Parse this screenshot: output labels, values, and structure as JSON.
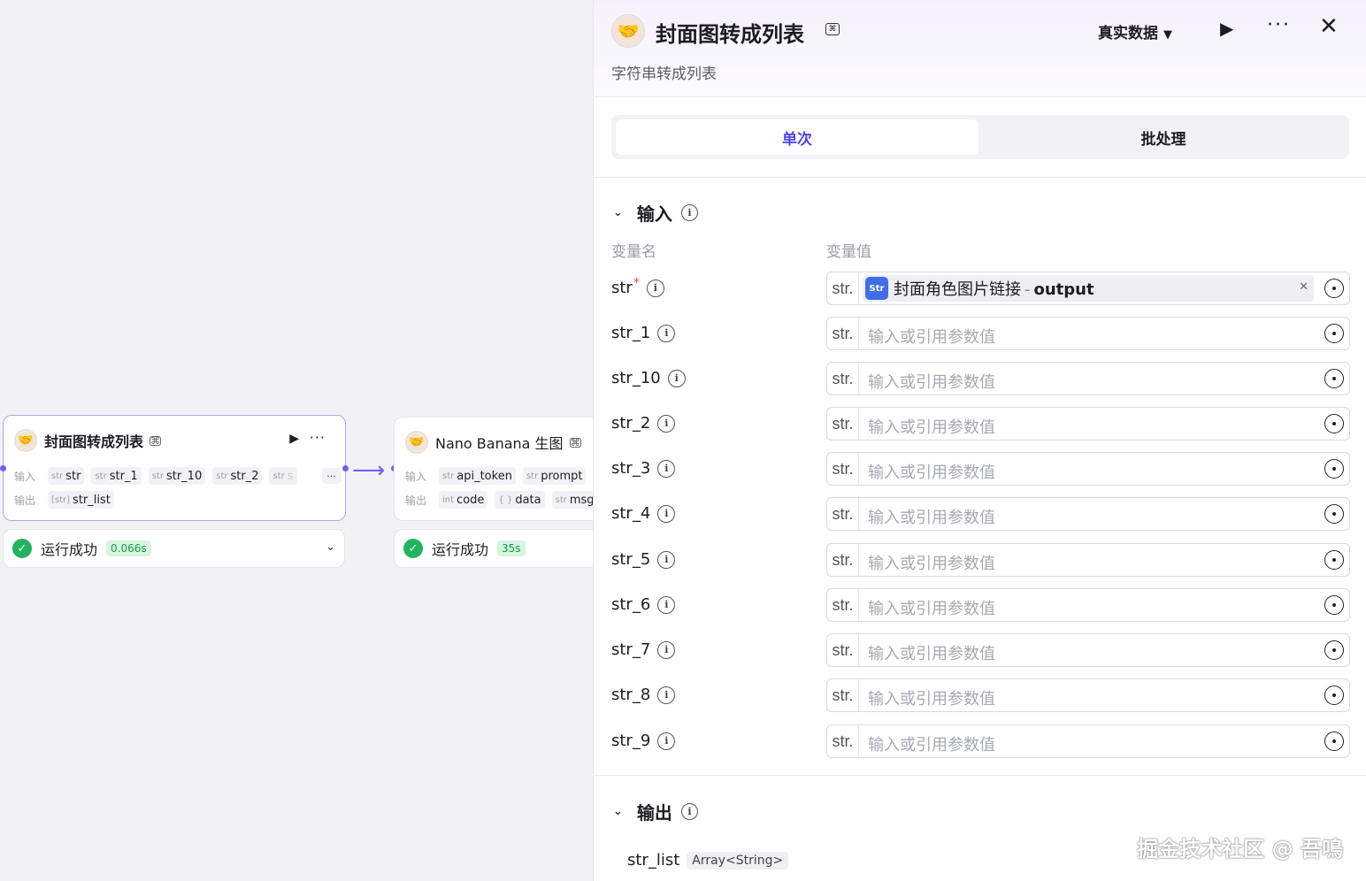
{
  "canvas": {
    "node1": {
      "title": "封面图转成列表",
      "input_label": "输入",
      "output_label": "输出",
      "inputs": [
        {
          "type": "str",
          "name": "str"
        },
        {
          "type": "str",
          "name": "str_1"
        },
        {
          "type": "str",
          "name": "str_10"
        },
        {
          "type": "str",
          "name": "str_2"
        },
        {
          "type": "str",
          "name": "s"
        }
      ],
      "more": "···",
      "outputs": [
        {
          "type": "[str]",
          "name": "str_list"
        }
      ],
      "status": "运行成功",
      "time": "0.066s"
    },
    "node2": {
      "title": "Nano Banana 生图",
      "input_label": "输入",
      "output_label": "输出",
      "inputs": [
        {
          "type": "str",
          "name": "api_token"
        },
        {
          "type": "str",
          "name": "prompt"
        }
      ],
      "outputs": [
        {
          "type": "int",
          "name": "code"
        },
        {
          "type": "{ }",
          "name": "data"
        },
        {
          "type": "str",
          "name": "msg"
        }
      ],
      "status": "运行成功",
      "time": "35s"
    }
  },
  "panel": {
    "title": "封面图转成列表",
    "subtitle": "字符串转成列表",
    "data_mode": "真实数据",
    "tabs": [
      "单次",
      "批处理"
    ],
    "input_section": "输入",
    "col_name": "变量名",
    "col_value": "变量值",
    "type_label": "str.",
    "placeholder": "输入或引用参数值",
    "ref": {
      "icon": "Str",
      "source": "封面角色图片链接",
      "sep": "-",
      "field": "output"
    },
    "vars": [
      "str",
      "str_1",
      "str_10",
      "str_2",
      "str_3",
      "str_4",
      "str_5",
      "str_6",
      "str_7",
      "str_8",
      "str_9"
    ],
    "output_section": "输出",
    "output": {
      "name": "str_list",
      "type": "Array<String>"
    }
  },
  "watermark": "掘金技术社区 @ 吾鳴",
  "colors": {
    "accent": "#5046e5",
    "success": "#22b35e",
    "edge": "#6d63f0"
  }
}
